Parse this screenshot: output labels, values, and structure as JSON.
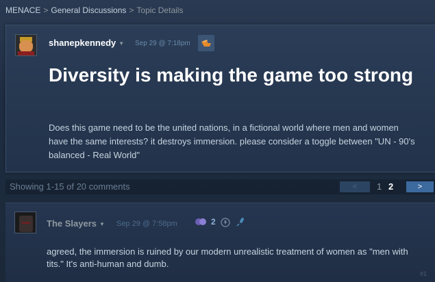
{
  "breadcrumb": {
    "items": [
      "MENACE",
      "General Discussions"
    ],
    "current": "Topic Details",
    "separator": ">"
  },
  "topic": {
    "author": "shanepkennedy",
    "date": "Sep 29 @ 7:18pm",
    "title": "Diversity is making the game too strong",
    "body": "Does this game need to be the united nations, in a fictional world where men and women have the same interests? it destroys immersion. please consider a toggle between \"UN - 90's balanced - Real World\""
  },
  "pager": {
    "showing": "Showing 1-15 of 20 comments",
    "prev": "<",
    "pages": [
      "1",
      "2"
    ],
    "current_page": "2",
    "next": ">"
  },
  "comment": {
    "author": "The Slayers",
    "date": "Sep 29 @ 7:58pm",
    "reaction_count": "2",
    "body": "agreed, the immersion is ruined by our modern unrealistic treatment of women as \"men with tits.\" It's anti-human and dumb.",
    "index": "#1"
  },
  "colors": {
    "background": "#1b2838",
    "accent": "#3d6a9e",
    "text": "#c6d4df"
  }
}
